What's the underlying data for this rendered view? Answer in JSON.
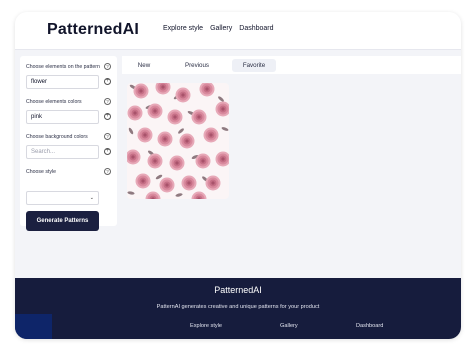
{
  "header": {
    "logo": "PatternedAI",
    "nav": [
      "Explore style",
      "Gallery",
      "Dashboard"
    ]
  },
  "sidebar": {
    "elements_label": "Choose elements on the pattern",
    "elements_value": "flower",
    "colors_label": "Choose elements colors",
    "colors_value": "pink",
    "background_label": "Choose background colors",
    "background_placeholder": "Search...",
    "style_label": "Choose style",
    "style_value": "",
    "generate_label": "Generate Patterns"
  },
  "tabs": {
    "new": "New",
    "previous": "Previous",
    "favorite": "Favorite",
    "active": "Favorite"
  },
  "pattern": {
    "description_icon": "rose-pattern-image"
  },
  "footer": {
    "title": "PatternedAI",
    "description": "PatternAI generates creative and unique patterns for your product",
    "links": [
      "Explore style",
      "Gallery",
      "Dashboard"
    ]
  },
  "colors": {
    "navy": "#161c3d",
    "button": "#1b2040",
    "page_bg": "#f3f4f8",
    "rose": "#d98a9e"
  }
}
